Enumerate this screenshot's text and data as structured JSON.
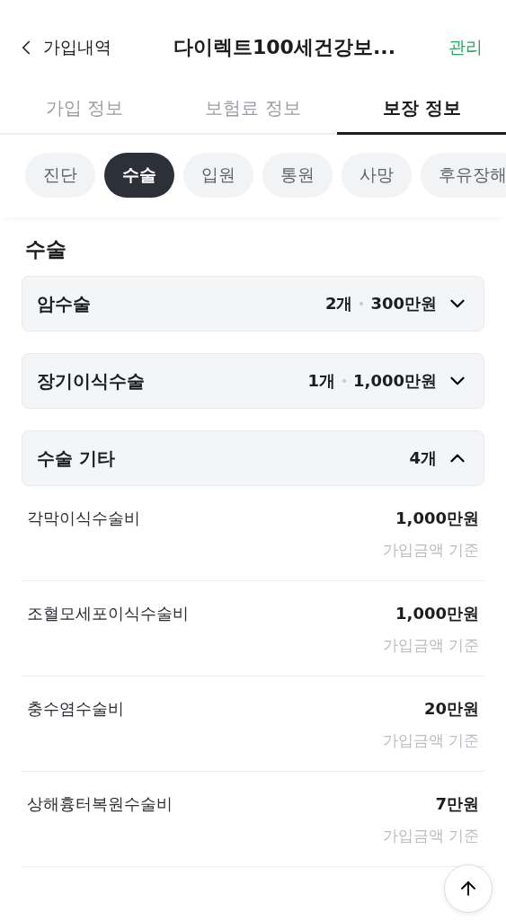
{
  "header": {
    "back_label": "가입내역",
    "title": "다이렉트100세건강보...",
    "action": "관리"
  },
  "tabs": [
    {
      "label": "가입 정보",
      "selected": false
    },
    {
      "label": "보험료 정보",
      "selected": false
    },
    {
      "label": "보장 정보",
      "selected": true
    }
  ],
  "chips": [
    {
      "label": "진단",
      "selected": false
    },
    {
      "label": "수술",
      "selected": true
    },
    {
      "label": "입원",
      "selected": false
    },
    {
      "label": "통원",
      "selected": false
    },
    {
      "label": "사망",
      "selected": false
    },
    {
      "label": "후유장해",
      "selected": false
    }
  ],
  "section_title": "수술",
  "groups": [
    {
      "title": "암수술",
      "count": "2개",
      "amount": "300만원",
      "expanded": false
    },
    {
      "title": "장기이식수술",
      "count": "1개",
      "amount": "1,000만원",
      "expanded": false
    },
    {
      "title": "수술 기타",
      "count": "4개",
      "expanded": true,
      "items": [
        {
          "name": "각막이식수술비",
          "amount": "1,000만원",
          "note": "가입금액 기준"
        },
        {
          "name": "조혈모세포이식수술비",
          "amount": "1,000만원",
          "note": "가입금액 기준"
        },
        {
          "name": "충수염수술비",
          "amount": "20만원",
          "note": "가입금액 기준"
        },
        {
          "name": "상해흉터복원수술비",
          "amount": "7만원",
          "note": "가입금액 기준"
        }
      ]
    }
  ]
}
